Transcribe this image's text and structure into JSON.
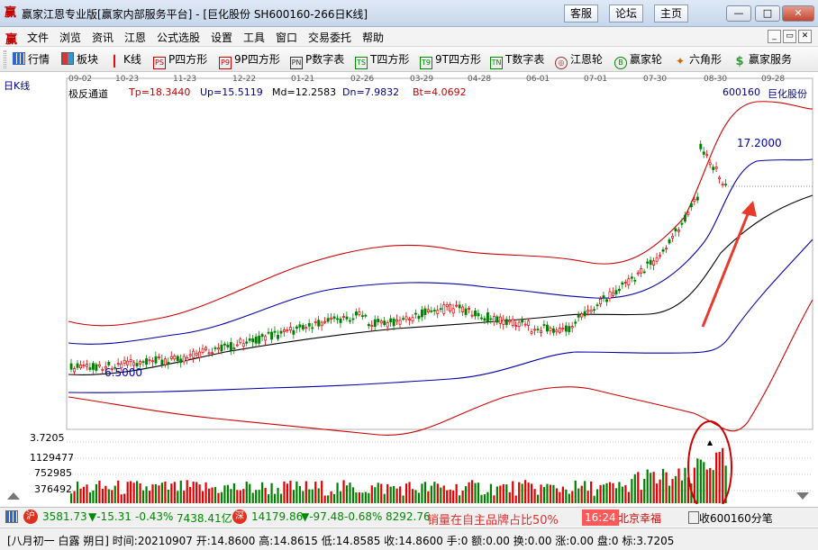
{
  "titlebar": {
    "title": "赢家江恩专业版[赢家内部服务平台] - [巨化股份  SH600160-266日K线]",
    "links": [
      "客服",
      "论坛",
      "主页"
    ],
    "min_label": "—",
    "max_label": "□",
    "close_label": "✕"
  },
  "menubar": {
    "logo": "赢",
    "items": [
      "文件",
      "浏览",
      "资讯",
      "江恩",
      "公式选股",
      "设置",
      "工具",
      "窗口",
      "交易委托",
      "帮助"
    ],
    "mdi": [
      "_",
      "▭",
      "✕"
    ]
  },
  "toolbar": {
    "items": [
      {
        "label": "行情",
        "icon": "grid-icon"
      },
      {
        "label": "板块",
        "icon": "blocks-icon"
      },
      {
        "label": "K线",
        "icon": "candlestick-icon"
      },
      {
        "label": "P四方形",
        "icon": "ps-icon",
        "badge": "PS"
      },
      {
        "label": "9P四方形",
        "icon": "p9-icon",
        "badge": "P9"
      },
      {
        "label": "P数字表",
        "icon": "pn-icon",
        "badge": "PN"
      },
      {
        "label": "T四方形",
        "icon": "ts-icon",
        "badge": "TS"
      },
      {
        "label": "9T四方形",
        "icon": "t9-icon",
        "badge": "T9"
      },
      {
        "label": "T数字表",
        "icon": "tn-icon",
        "badge": "TN"
      },
      {
        "label": "江恩轮",
        "icon": "gann-wheel-icon",
        "badge": "◎"
      },
      {
        "label": "赢家轮",
        "icon": "winner-wheel-icon",
        "badge": "B"
      },
      {
        "label": "六角形",
        "icon": "hexagon-icon",
        "badge": "✦"
      },
      {
        "label": "赢家服务",
        "icon": "dollar-icon",
        "badge": "$"
      }
    ]
  },
  "chart": {
    "period_label": "日K线",
    "indicator_name": "极反通道",
    "indicators": {
      "tp": "Tp=18.3440",
      "up": "Up=15.5119",
      "md": "Md=12.2583",
      "dn": "Dn=7.9832",
      "bt": "Bt=4.0692"
    },
    "stock_code": "600160",
    "stock_name": "巨化股份",
    "high_marker": "17.2000",
    "low_marker": "6.5000",
    "dates": [
      "09-02",
      "10-23",
      "11-23",
      "12-22",
      "01-21",
      "02-26",
      "03-29",
      "04-28",
      "06-01",
      "07-01",
      "07-30",
      "08-30",
      "09-28"
    ],
    "volume_axis": [
      "3.7205",
      "1129477",
      "752985",
      "376492"
    ],
    "colors": {
      "up": "#e00000",
      "down": "#008000",
      "outer": "#cc0000",
      "inner": "#0000aa",
      "mid": "#000000",
      "arrow": "#e83a2a"
    }
  },
  "status1": {
    "sh_icon": "沪",
    "sh_index": "3581.73",
    "sh_change": "▼-15.31",
    "sh_pct": "-0.43%",
    "sh_amount": "7438.41亿",
    "sz_icon": "深",
    "sz_index": "14179.86",
    "sz_change": "▼-97.48",
    "sz_pct": "-0.68%",
    "sz_amount": "8292.76",
    "ad_text": "销量在自主品牌占比50%",
    "clock": "16:24",
    "news": "北京幸福",
    "receive": "收600160分笔"
  },
  "status2": {
    "info": "[八月初一 白露 朔日] 时间:20210907 开:14.8600 高:14.8615 低:14.8585 收:14.8600 手:0 额:0.00 换:0.00 涨:0.00 盘:0 标:3.7205"
  }
}
